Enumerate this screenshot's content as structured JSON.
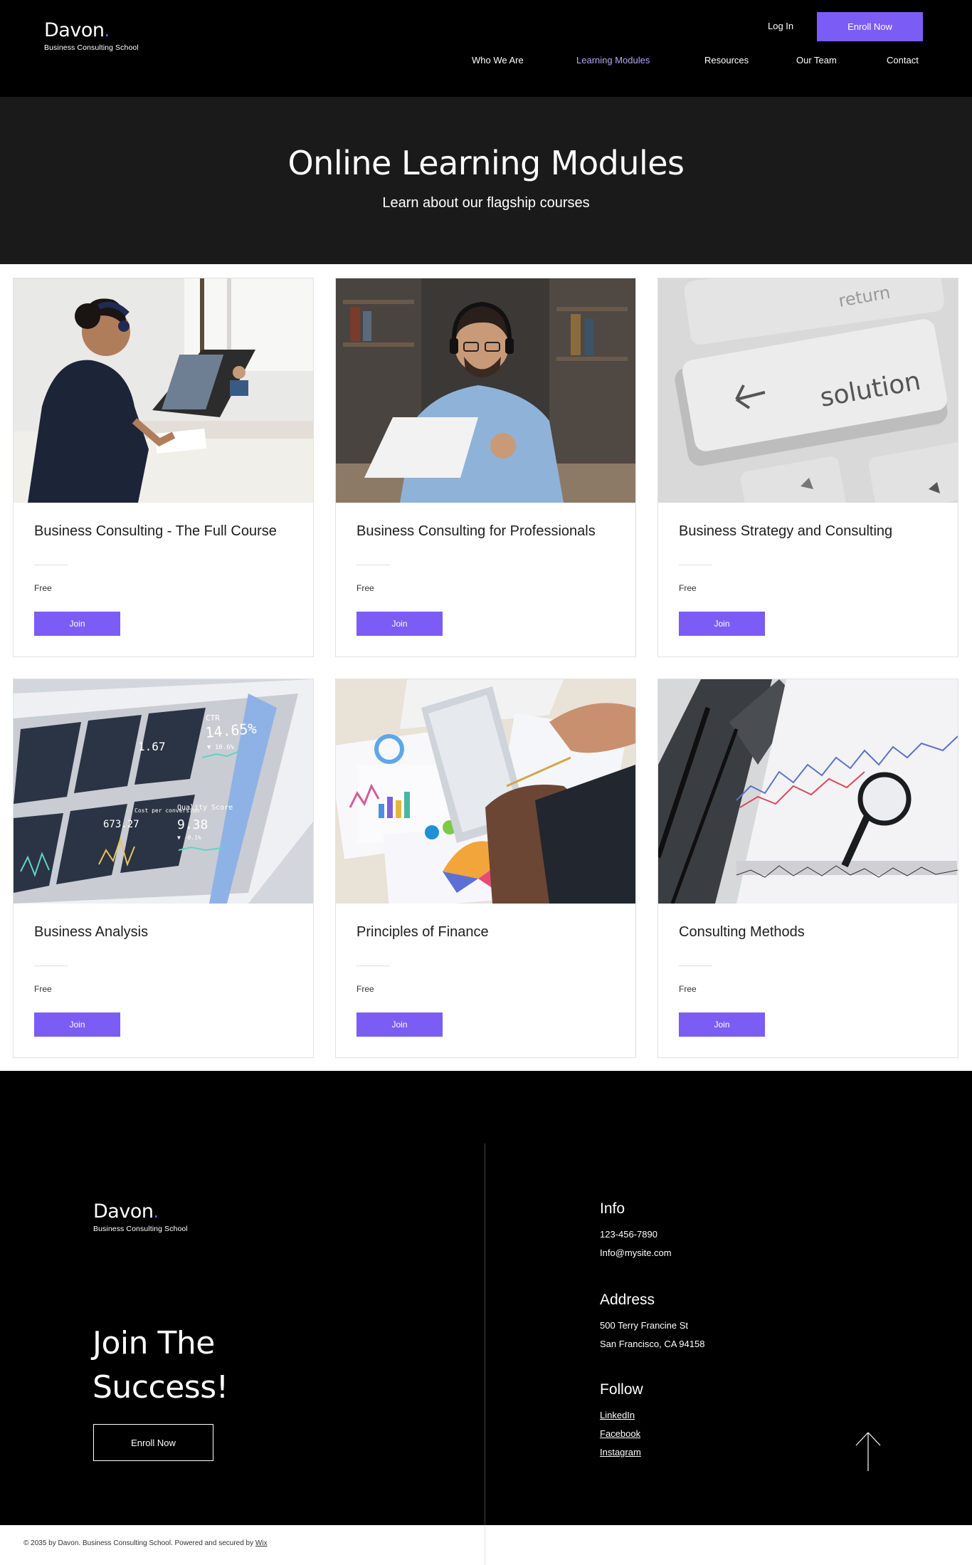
{
  "header": {
    "logo": "Davon",
    "logo_dot": ".",
    "logo_sub": "Business Consulting School",
    "login": "Log In",
    "enroll": "Enroll Now",
    "nav": [
      "Who We Are",
      "Learning Modules",
      "Resources",
      "Our Team",
      "Contact"
    ],
    "active_nav": "Learning Modules"
  },
  "hero": {
    "title": "Online Learning Modules",
    "subtitle": "Learn about our flagship courses"
  },
  "courses": [
    {
      "title": "Business Consulting - The Full Course",
      "price": "Free",
      "button": "Join"
    },
    {
      "title": "Business Consulting for Professionals",
      "price": "Free",
      "button": "Join"
    },
    {
      "title": "Business Strategy and Consulting",
      "price": "Free",
      "button": "Join"
    },
    {
      "title": "Business Analysis",
      "price": "Free",
      "button": "Join"
    },
    {
      "title": "Principles of Finance",
      "price": "Free",
      "button": "Join"
    },
    {
      "title": "Consulting Methods",
      "price": "Free",
      "button": "Join"
    }
  ],
  "image_text": {
    "key_return": "return",
    "key_solution": "solution",
    "ctr_label": "CTR",
    "ctr_value": "14.65%",
    "ctr_delta": "▼ 10.6%",
    "value_167": "1.67",
    "cost_label": "Cost per conversion",
    "cost_value": "673.27",
    "qs_label": "Quality Score",
    "qs_value": "9.38",
    "qs_delta": "▼ -0.1%"
  },
  "footer": {
    "logo": "Davon",
    "logo_dot": ".",
    "logo_sub": "Business Consulting School",
    "headline_1": "Join The",
    "headline_2": "Success!",
    "enroll": "Enroll Now",
    "info_heading": "Info",
    "phone": "123-456-7890",
    "email": "Info@mysite.com",
    "address_heading": "Address",
    "address_1": "500 Terry Francine St",
    "address_2": "San Francisco, CA 94158",
    "follow_heading": "Follow",
    "links": [
      "LinkedIn",
      "Facebook",
      "Instagram"
    ],
    "copyright": "© 2035 by Davon. Business Consulting School. Powered and secured by",
    "wix": "Wix"
  },
  "colors": {
    "accent": "#7b5cf5",
    "header_bg": "#000000",
    "hero_bg": "#1a1a1a"
  }
}
